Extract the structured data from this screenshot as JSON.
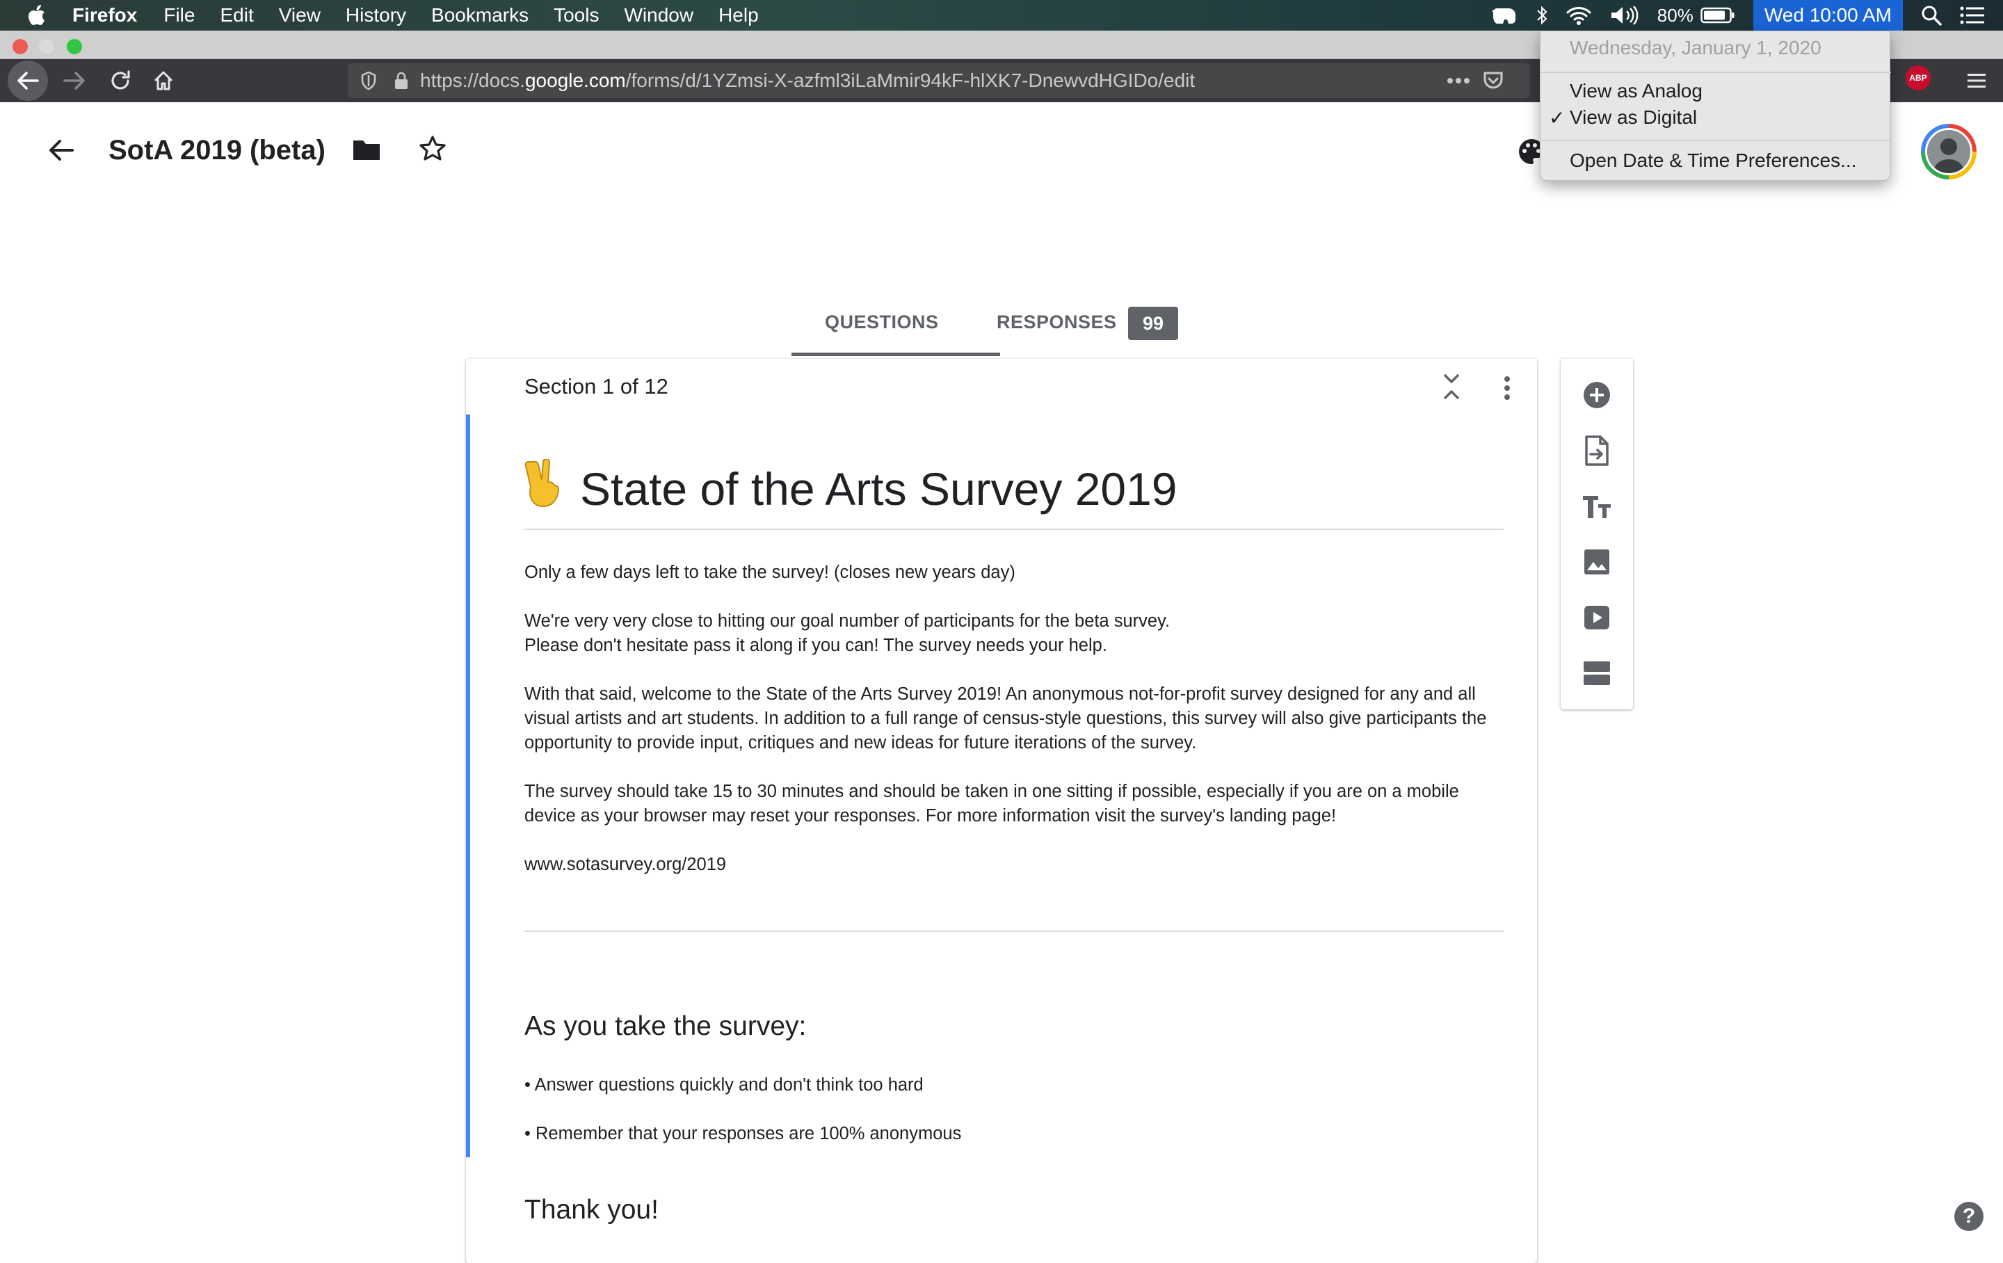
{
  "menubar": {
    "app_name": "Firefox",
    "items": [
      "File",
      "Edit",
      "View",
      "History",
      "Bookmarks",
      "Tools",
      "Window",
      "Help"
    ],
    "battery_percent": "80%",
    "clock": "Wed 10:00 AM",
    "icons": [
      "apple-icon",
      "evernote-icon",
      "bluetooth-icon",
      "wifi-icon",
      "volume-icon",
      "battery-icon",
      "spotlight-icon",
      "notification-center-icon"
    ]
  },
  "browser": {
    "url_prefix": "https://docs.",
    "url_domain": "google.com",
    "url_path": "/forms/d/1YZmsi-X-azfml3iLaMmir94kF-hlXK7-DnewvdHGIDo/edit",
    "extension_badge": "ABP"
  },
  "clock_menu": {
    "date": "Wednesday, January 1, 2020",
    "view_analog": "View as Analog",
    "view_digital": "View as Digital",
    "checkmark": "✓",
    "preferences": "Open Date & Time Preferences..."
  },
  "form_header": {
    "title": "SotA 2019 (beta)"
  },
  "tabs": {
    "questions": "QUESTIONS",
    "responses": "RESPONSES",
    "responses_count": "99"
  },
  "section": {
    "label": "Section 1 of 12",
    "title_emoji": "✌️",
    "title": "State of the Arts Survey 2019",
    "paragraphs": [
      "Only a few days left to take the survey! (closes new years day)",
      "We're very very close to hitting our goal number of participants for the beta survey.",
      "Please don't hesitate pass it along if you can! The survey needs your help.",
      "With that said, welcome to the State of the Arts Survey 2019! An anonymous not-for-profit survey designed for any and all visual artists and art students. In addition to a full range of census-style questions, this survey will also give participants the opportunity to provide input, critiques and new ideas for future iterations of the survey.",
      "The survey should take 15 to 30 minutes and should be taken in one sitting if possible, especially if you are on a mobile device as your browser may reset your responses. For more information visit the survey's landing page!",
      "www.sotasurvey.org/2019"
    ],
    "subheading": "As you take the survey:",
    "bullets": [
      "• Answer questions quickly and don't think too hard",
      "• Remember that your responses are 100% anonymous"
    ],
    "closing": "Thank you!"
  },
  "help": "?"
}
